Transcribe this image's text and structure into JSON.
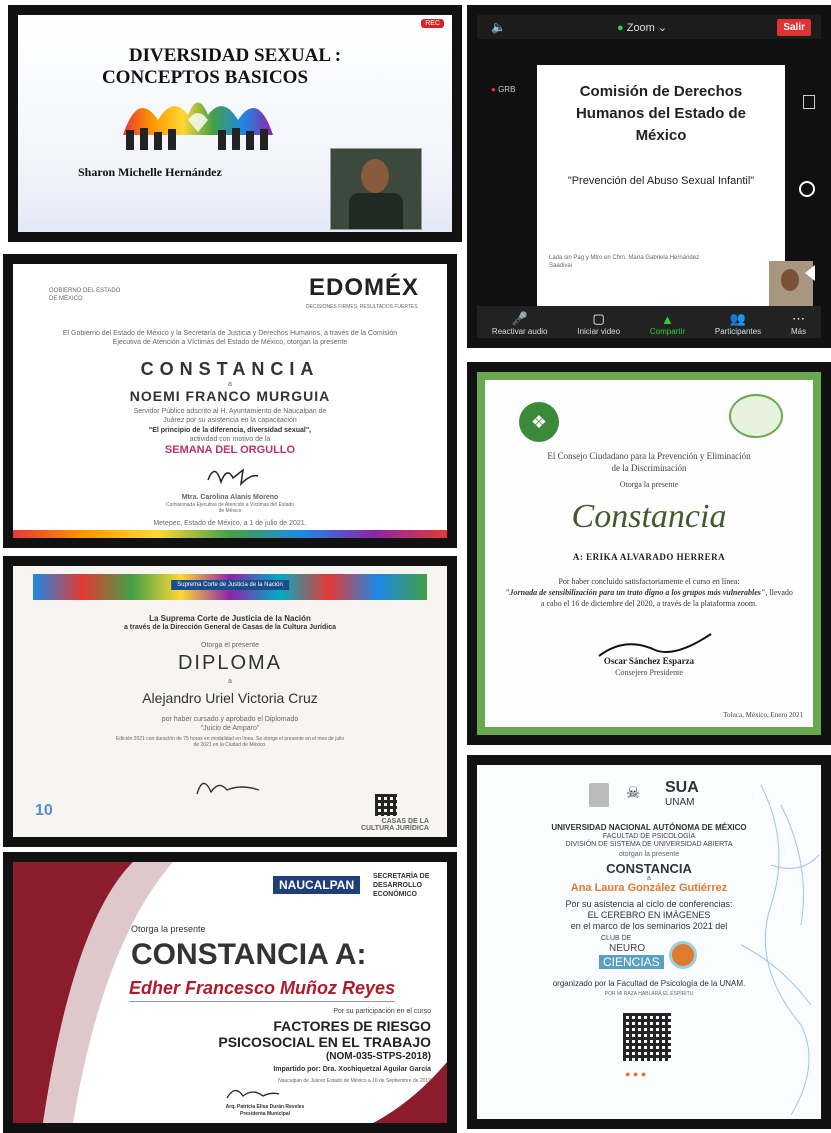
{
  "p1": {
    "title": "DIVERSIDAD SEXUAL :",
    "title2": "CONCEPTOS BASICOS",
    "author": "Sharon Michelle Hernández",
    "rec": "REC"
  },
  "p2": {
    "app": "Zoom",
    "exit": "Salir",
    "grb": "GRB",
    "title": "Comisión de Derechos Humanos del Estado de México",
    "subtitle": "\"Prevención del Abuso Sexual Infantil\"",
    "footer": "Lada sin Pag y Mtro en Chm. María Gabriela Hernández Saadivai",
    "controls": [
      "Reactivar audio",
      "Iniciar video",
      "Compartir",
      "Participantes",
      "Más"
    ]
  },
  "p3": {
    "header_left": "GOBIERNO DEL ESTADO DE MÉXICO",
    "logo": "EDOMÉX",
    "logo_tag": "DECISIONES FIRMES, RESULTADOS FUERTES.",
    "intro": "El Gobierno del Estado de México y la Secretaría de Justicia y Derechos Humanos, a través de la Comisión Ejecutiva de Atención a Víctimas del Estado de México, otorgan la presente",
    "title": "CONSTANCIA",
    "a": "a",
    "name": "NOEMI FRANCO MURGUIA",
    "body": "Servidor Público adscrito al H. Ayuntamiento de Naucalpan de Juárez por su asistencia en la capacitación",
    "course": "\"El principio de la diferencia, diversidad sexual\",",
    "event_intro": "actividad con motivo de la",
    "event": "SEMANA DEL ORGULLO",
    "signer": "Mtra. Carolina Alanís Moreno",
    "signer_role": "Comisionada Ejecutiva de Atención a Víctimas del Estado de México",
    "place": "Metepec, Estado de México, a 1 de julio de 2021."
  },
  "p4": {
    "intro": "El Consejo Ciudadano para la Prevención y Eliminación de la Discriminación",
    "otorga": "Otorga la presente",
    "title": "Constancia",
    "name": "A: ERIKA ALVARADO HERRERA",
    "body": "Por haber concluido satisfactoriamente el curso en línea:",
    "course": "\"Jornada de sensibilización para un trato digno a los grupos más vulnerables\"",
    "body2": ", llevado a cabo el 16 de diciembre del 2020, a través de la plataforma zoom.",
    "signer": "Oscar Sánchez Esparza",
    "signer_role": "Consejero Presidente",
    "place": "Toluca, México, Enero 2021"
  },
  "p5": {
    "banner": "Suprema Corte de Justicia de la Nación",
    "org": "La Suprema Corte de Justicia de la Nación",
    "org2": "a través de la Dirección General de Casas de la Cultura Jurídica",
    "otorga": "Otorga el presente",
    "title": "DIPLOMA",
    "a": "a",
    "name": "Alejandro Uriel Victoria Cruz",
    "body": "por haber cursado y aprobado el Diplomado",
    "course": "\"Juicio de Amparo\"",
    "body2": "Edición 2021 con duración de 75 horas en modalidad en línea. Se otorga el presente en el mes de julio de 2021 en la Ciudad de México.",
    "footer_logo": "CASAS DE LA CULTURA JURÍDICA"
  },
  "p6": {
    "unam": "UNIVERSIDAD NACIONAL AUTÓNOMA DE MÉXICO",
    "fac": "FACULTAD DE PSICOLOGÍA",
    "div": "DIVISIÓN DE SISTEMA DE UNIVERSIDAD ABIERTA",
    "otorgan": "otorgan la presente",
    "title": "CONSTANCIA",
    "a": "a",
    "name": "Ana Laura González Gutiérrez",
    "body": "Por su asistencia al ciclo de conferencias:",
    "course": "EL CEREBRO EN IMÁGENES",
    "body2": "en el marco de los seminarios 2021 del",
    "club": "CLUB DE",
    "neuro": "NEURO",
    "ciencias": "CIENCIAS",
    "org": "organizado por la Facultad de Psicología de la UNAM.",
    "motto": "POR MI RAZA HABLARÁ EL ESPÍRITU",
    "sua": "SUA",
    "sua_unam": "UNAM"
  },
  "p7": {
    "logo": "NAUCALPAN",
    "sec": "SECRETARÍA DE DESARROLLO ECONÓMICO",
    "otorga": "Otorga la presente",
    "title": "CONSTANCIA A:",
    "name": "Edher Francesco Muñoz Reyes",
    "body": "Por su participación en el curso",
    "course1": "FACTORES DE RIESGO",
    "course2": "PSICOSOCIAL EN EL TRABAJO",
    "course3": "(NOM-035-STPS-2018)",
    "impart": "Impartido por: Dra. Xochiquetzal Aguilar García",
    "place": "Naucalpan de Juárez Estado de México a 10 de Septiembre de 2019",
    "signer": "Arq. Patricia Elisa Durán Reveles",
    "signer_role": "Presidenta Municipal"
  }
}
